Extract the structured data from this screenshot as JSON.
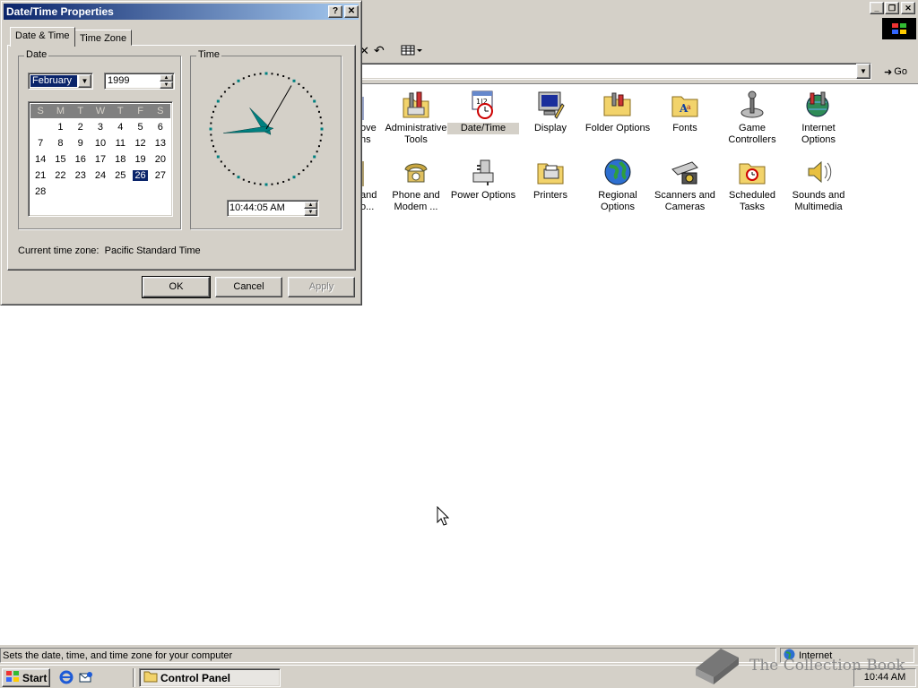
{
  "dialog": {
    "title": "Date/Time Properties",
    "help_btn": "?",
    "close_btn": "✕",
    "tabs": [
      "Date & Time",
      "Time Zone"
    ],
    "date_group": "Date",
    "time_group": "Time",
    "month": "February",
    "year": "1999",
    "weekdays": [
      "S",
      "M",
      "T",
      "W",
      "T",
      "F",
      "S"
    ],
    "days": [
      "",
      "1",
      "2",
      "3",
      "4",
      "5",
      "6",
      "7",
      "8",
      "9",
      "10",
      "11",
      "12",
      "13",
      "14",
      "15",
      "16",
      "17",
      "18",
      "19",
      "20",
      "21",
      "22",
      "23",
      "24",
      "25",
      "26",
      "27",
      "28"
    ],
    "selected_day": "26",
    "time": "10:44:05 AM",
    "tz_label": "Current time zone:",
    "tz_value": "Pacific Standard Time",
    "ok": "OK",
    "cancel": "Cancel",
    "apply": "Apply",
    "clock": {
      "hour": 10,
      "minute": 44,
      "second": 5
    }
  },
  "control_panel": {
    "go": "Go",
    "partial_labels": [
      "ove",
      "ns",
      "and",
      "o..."
    ],
    "icons": [
      {
        "name": "administrative-tools",
        "label1": "Administrative",
        "label2": "Tools"
      },
      {
        "name": "date-time",
        "label1": "Date/Time",
        "label2": ""
      },
      {
        "name": "display",
        "label1": "Display",
        "label2": ""
      },
      {
        "name": "folder-options",
        "label1": "Folder Options",
        "label2": ""
      },
      {
        "name": "fonts",
        "label1": "Fonts",
        "label2": ""
      },
      {
        "name": "game-controllers",
        "label1": "Game",
        "label2": "Controllers"
      },
      {
        "name": "internet-options",
        "label1": "Internet",
        "label2": "Options"
      },
      {
        "name": "phone-and-modem",
        "label1": "Phone and",
        "label2": "Modem ..."
      },
      {
        "name": "power-options",
        "label1": "Power Options",
        "label2": ""
      },
      {
        "name": "printers",
        "label1": "Printers",
        "label2": ""
      },
      {
        "name": "regional-options",
        "label1": "Regional",
        "label2": "Options"
      },
      {
        "name": "scanners-and-cameras",
        "label1": "Scanners and",
        "label2": "Cameras"
      },
      {
        "name": "scheduled-tasks",
        "label1": "Scheduled",
        "label2": "Tasks"
      },
      {
        "name": "sounds-and-multimedia",
        "label1": "Sounds and",
        "label2": "Multimedia"
      }
    ],
    "status": "Sets the date, time, and time zone for your computer",
    "zone": "Internet"
  },
  "taskbar": {
    "start": "Start",
    "task": "Control Panel",
    "clock": "10:44 AM"
  },
  "watermark": "The Collection Book"
}
